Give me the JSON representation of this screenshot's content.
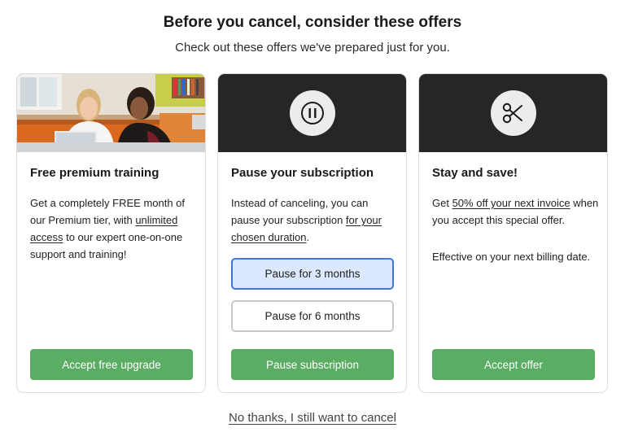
{
  "header": {
    "title": "Before you cancel, consider these offers",
    "subtitle": "Check out these offers we've prepared just for you."
  },
  "offers": [
    {
      "heading": "Free premium training",
      "image": "photo-two-women-laptop",
      "body_before": "Get a completely FREE month of our Premium tier, with ",
      "body_link": "unlimited access",
      "body_after": " to our expert one-on-one support and training!",
      "cta_label": "Accept free upgrade"
    },
    {
      "heading": "Pause your subscription",
      "icon": "pause-icon",
      "body_before": "Instead of canceling, you can pause your subscription ",
      "body_link": "for your chosen duration",
      "body_after": ".",
      "options": [
        {
          "label": "Pause for 3 months",
          "selected": true
        },
        {
          "label": "Pause for 6 months",
          "selected": false
        }
      ],
      "cta_label": "Pause subscription"
    },
    {
      "heading": "Stay and save!",
      "icon": "scissors-icon",
      "body_before": "Get ",
      "body_link": "50% off your next invoice",
      "body_after": " when you accept this special offer.",
      "body_extra": "Effective on your next billing date.",
      "cta_label": "Accept offer"
    }
  ],
  "decline_label": "No thanks, I still want to cancel",
  "colors": {
    "cta": "#5aad62",
    "hero_dark": "#262626",
    "selected_bg": "#dce8fd",
    "selected_border": "#3f78da"
  }
}
